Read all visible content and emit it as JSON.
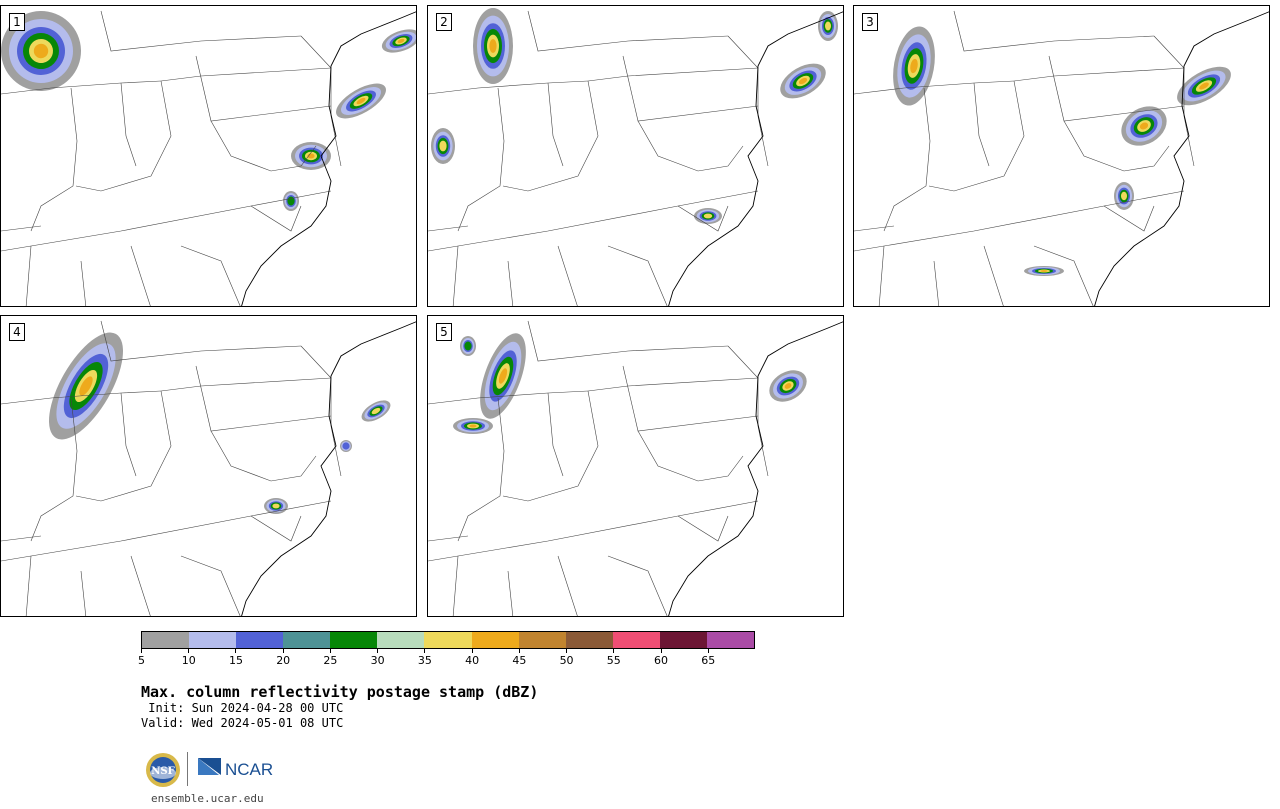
{
  "panels": [
    {
      "id": "1",
      "label": "1"
    },
    {
      "id": "2",
      "label": "2"
    },
    {
      "id": "3",
      "label": "3"
    },
    {
      "id": "4",
      "label": "4"
    },
    {
      "id": "5",
      "label": "5"
    }
  ],
  "colorbar": {
    "colors": [
      "#a0a0a0",
      "#b4bcec",
      "#5262d6",
      "#4e9396",
      "#078707",
      "#b8dcbc",
      "#eed95c",
      "#eeaa1c",
      "#c1842f",
      "#8b5a37",
      "#f04e74",
      "#6c1634",
      "#aa4ca6"
    ],
    "tick_labels": [
      "5",
      "10",
      "15",
      "20",
      "25",
      "30",
      "35",
      "40",
      "45",
      "50",
      "55",
      "60",
      "65"
    ]
  },
  "title": "Max. column reflectivity postage stamp (dBZ)",
  "init_text": " Init: Sun 2024-04-28 00 UTC",
  "valid_text": "Valid: Wed 2024-05-01 08 UTC",
  "logos": {
    "nsf": "NSF",
    "ncar": "NCAR"
  },
  "url": "ensemble.ucar.edu"
}
